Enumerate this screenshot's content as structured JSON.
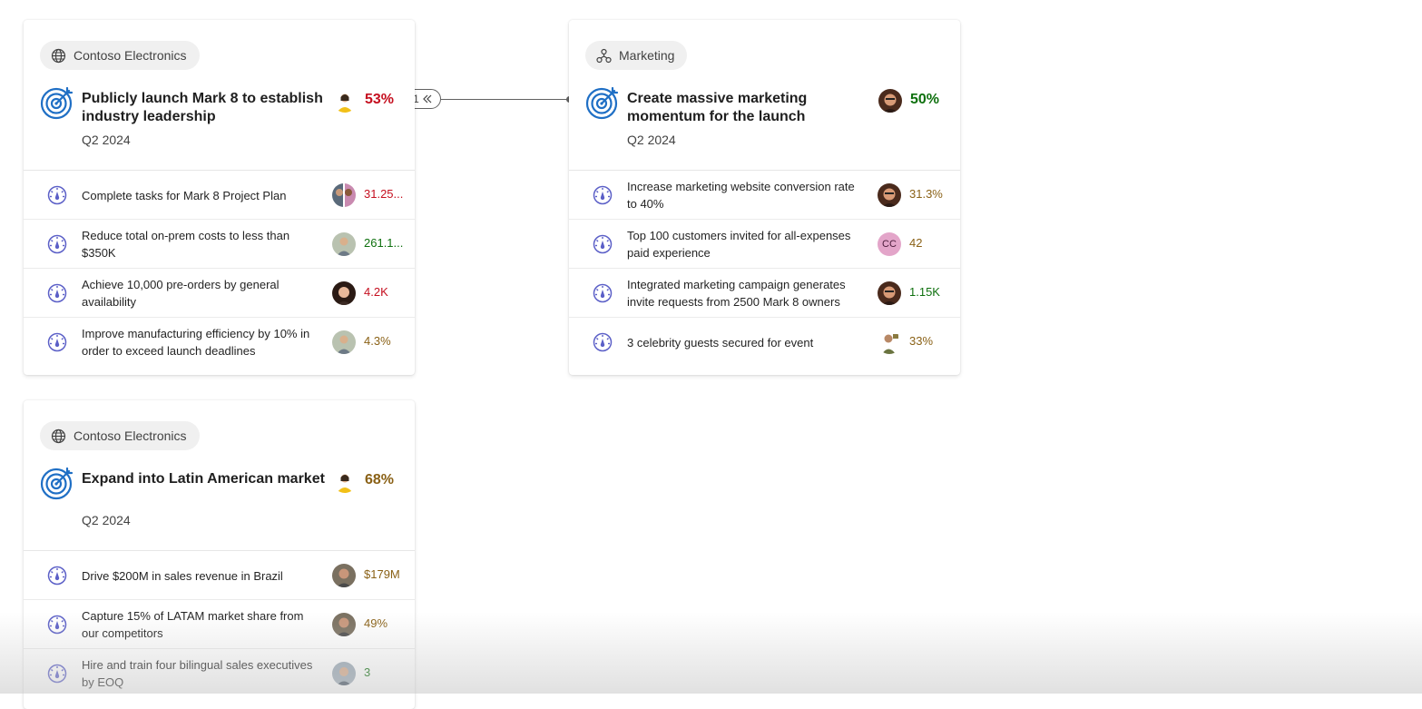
{
  "colors": {
    "red": "#c50f1f",
    "green": "#0e700e",
    "amber": "#8a6116",
    "icon_blue": "#1f6fc5",
    "kr_purple": "#5b5fc7"
  },
  "connector": {
    "collapsed_count": "1",
    "icon": "double-chevron-left-icon"
  },
  "cards": [
    {
      "chip": {
        "icon": "globe-icon",
        "label": "Contoso Electronics"
      },
      "title": "Publicly launch Mark 8 to establish industry leadership",
      "quarter": "Q2 2024",
      "progress": "53%",
      "progress_color": "#c50f1f",
      "key_results": [
        {
          "text": "Complete tasks for Mark 8 Project Plan",
          "value": "31.25...",
          "value_color": "#c50f1f"
        },
        {
          "text": "Reduce total on-prem costs to less than $350K",
          "value": "261.1...",
          "value_color": "#0e700e"
        },
        {
          "text": "Achieve 10,000 pre-orders by general availability",
          "value": "4.2K",
          "value_color": "#c50f1f"
        },
        {
          "text": "Improve manufacturing efficiency by 10% in order to exceed launch deadlines",
          "value": "4.3%",
          "value_color": "#8a6116"
        }
      ]
    },
    {
      "chip": {
        "icon": "org-chart-icon",
        "label": "Marketing"
      },
      "title": "Create massive marketing momentum for the launch",
      "quarter": "Q2 2024",
      "progress": "50%",
      "progress_color": "#0e700e",
      "key_results": [
        {
          "text": "Increase marketing website conversion rate to 40%",
          "value": "31.3%",
          "value_color": "#8a6116"
        },
        {
          "text": "Top 100 customers invited for all-expenses paid experience",
          "value": "42",
          "value_color": "#8a6116",
          "avatar_initials": "CC"
        },
        {
          "text": "Integrated marketing campaign generates invite requests from 2500 Mark 8 owners",
          "value": "1.15K",
          "value_color": "#0e700e"
        },
        {
          "text": "3 celebrity guests secured for event",
          "value": "33%",
          "value_color": "#8a6116"
        }
      ]
    },
    {
      "chip": {
        "icon": "globe-icon",
        "label": "Contoso Electronics"
      },
      "title": "Expand into Latin American market",
      "quarter": "Q2 2024",
      "progress": "68%",
      "progress_color": "#8a6116",
      "key_results": [
        {
          "text": "Drive $200M in sales revenue in Brazil",
          "value": "$179M",
          "value_color": "#8a6116"
        },
        {
          "text": "Capture 15% of LATAM market share from our competitors",
          "value": "49%",
          "value_color": "#8a6116"
        },
        {
          "text": "Hire and train four bilingual sales executives by EOQ",
          "value": "3",
          "value_color": "#0e700e"
        }
      ]
    }
  ]
}
